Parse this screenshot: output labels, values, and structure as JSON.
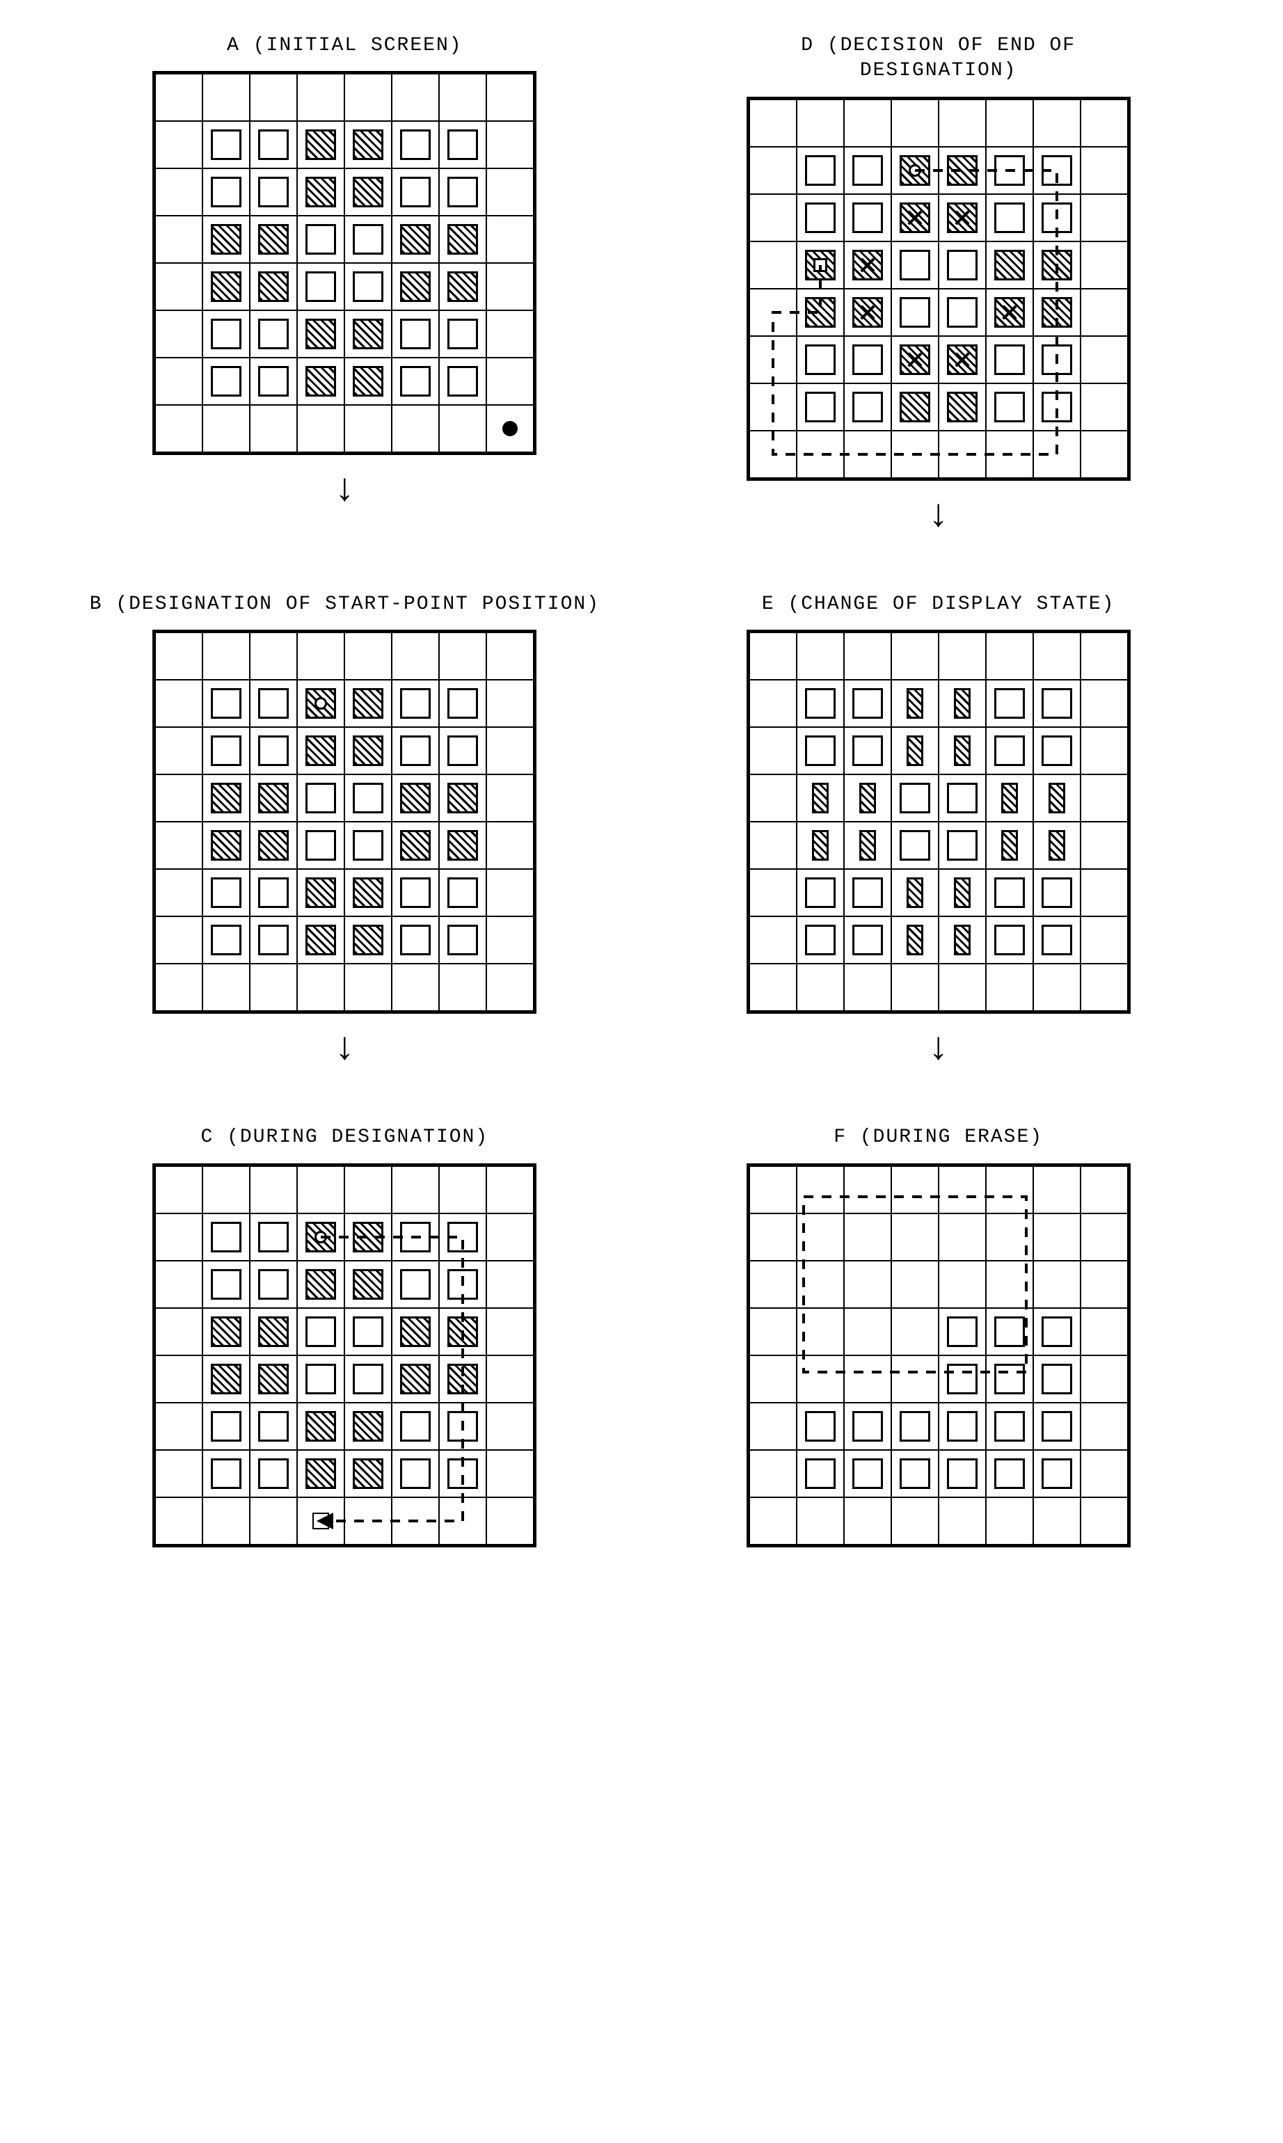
{
  "labels": {
    "A": "A (INITIAL SCREEN)",
    "B": "B (DESIGNATION OF START-POINT POSITION)",
    "C": "C (DURING DESIGNATION)",
    "D": "D (DECISION OF END OF\nDESIGNATION)",
    "E": "E (CHANGE OF DISPLAY STATE)",
    "F": "F (DURING ERASE)"
  },
  "cell_size": 68,
  "grid_dim": 8,
  "legend": {
    "empty": "empty tile (white square)",
    "hatched": "selected tile (diagonal hatch)",
    "half": "half-width hatched tile",
    "dot": "solid cursor dot",
    "ring": "start-point ring marker",
    "small": "small cursor square"
  },
  "grids": {
    "A": {
      "tiles": [
        {
          "r": 1,
          "c": 1,
          "t": "e"
        },
        {
          "r": 1,
          "c": 2,
          "t": "e"
        },
        {
          "r": 1,
          "c": 3,
          "t": "h"
        },
        {
          "r": 1,
          "c": 4,
          "t": "h"
        },
        {
          "r": 1,
          "c": 5,
          "t": "e"
        },
        {
          "r": 1,
          "c": 6,
          "t": "e"
        },
        {
          "r": 2,
          "c": 1,
          "t": "e"
        },
        {
          "r": 2,
          "c": 2,
          "t": "e"
        },
        {
          "r": 2,
          "c": 3,
          "t": "h"
        },
        {
          "r": 2,
          "c": 4,
          "t": "h"
        },
        {
          "r": 2,
          "c": 5,
          "t": "e"
        },
        {
          "r": 2,
          "c": 6,
          "t": "e"
        },
        {
          "r": 3,
          "c": 1,
          "t": "h"
        },
        {
          "r": 3,
          "c": 2,
          "t": "h"
        },
        {
          "r": 3,
          "c": 3,
          "t": "e"
        },
        {
          "r": 3,
          "c": 4,
          "t": "e"
        },
        {
          "r": 3,
          "c": 5,
          "t": "h"
        },
        {
          "r": 3,
          "c": 6,
          "t": "h"
        },
        {
          "r": 4,
          "c": 1,
          "t": "h"
        },
        {
          "r": 4,
          "c": 2,
          "t": "h"
        },
        {
          "r": 4,
          "c": 3,
          "t": "e"
        },
        {
          "r": 4,
          "c": 4,
          "t": "e"
        },
        {
          "r": 4,
          "c": 5,
          "t": "h"
        },
        {
          "r": 4,
          "c": 6,
          "t": "h"
        },
        {
          "r": 5,
          "c": 1,
          "t": "e"
        },
        {
          "r": 5,
          "c": 2,
          "t": "e"
        },
        {
          "r": 5,
          "c": 3,
          "t": "h"
        },
        {
          "r": 5,
          "c": 4,
          "t": "h"
        },
        {
          "r": 5,
          "c": 5,
          "t": "e"
        },
        {
          "r": 5,
          "c": 6,
          "t": "e"
        },
        {
          "r": 6,
          "c": 1,
          "t": "e"
        },
        {
          "r": 6,
          "c": 2,
          "t": "e"
        },
        {
          "r": 6,
          "c": 3,
          "t": "h"
        },
        {
          "r": 6,
          "c": 4,
          "t": "h"
        },
        {
          "r": 6,
          "c": 5,
          "t": "e"
        },
        {
          "r": 6,
          "c": 6,
          "t": "e"
        }
      ],
      "markers": [
        {
          "r": 7,
          "c": 7,
          "m": "dot"
        }
      ]
    },
    "B": {
      "tiles": [
        {
          "r": 1,
          "c": 1,
          "t": "e"
        },
        {
          "r": 1,
          "c": 2,
          "t": "e"
        },
        {
          "r": 1,
          "c": 3,
          "t": "h"
        },
        {
          "r": 1,
          "c": 4,
          "t": "h"
        },
        {
          "r": 1,
          "c": 5,
          "t": "e"
        },
        {
          "r": 1,
          "c": 6,
          "t": "e"
        },
        {
          "r": 2,
          "c": 1,
          "t": "e"
        },
        {
          "r": 2,
          "c": 2,
          "t": "e"
        },
        {
          "r": 2,
          "c": 3,
          "t": "h"
        },
        {
          "r": 2,
          "c": 4,
          "t": "h"
        },
        {
          "r": 2,
          "c": 5,
          "t": "e"
        },
        {
          "r": 2,
          "c": 6,
          "t": "e"
        },
        {
          "r": 3,
          "c": 1,
          "t": "h"
        },
        {
          "r": 3,
          "c": 2,
          "t": "h"
        },
        {
          "r": 3,
          "c": 3,
          "t": "e"
        },
        {
          "r": 3,
          "c": 4,
          "t": "e"
        },
        {
          "r": 3,
          "c": 5,
          "t": "h"
        },
        {
          "r": 3,
          "c": 6,
          "t": "h"
        },
        {
          "r": 4,
          "c": 1,
          "t": "h"
        },
        {
          "r": 4,
          "c": 2,
          "t": "h"
        },
        {
          "r": 4,
          "c": 3,
          "t": "e"
        },
        {
          "r": 4,
          "c": 4,
          "t": "e"
        },
        {
          "r": 4,
          "c": 5,
          "t": "h"
        },
        {
          "r": 4,
          "c": 6,
          "t": "h"
        },
        {
          "r": 5,
          "c": 1,
          "t": "e"
        },
        {
          "r": 5,
          "c": 2,
          "t": "e"
        },
        {
          "r": 5,
          "c": 3,
          "t": "h"
        },
        {
          "r": 5,
          "c": 4,
          "t": "h"
        },
        {
          "r": 5,
          "c": 5,
          "t": "e"
        },
        {
          "r": 5,
          "c": 6,
          "t": "e"
        },
        {
          "r": 6,
          "c": 1,
          "t": "e"
        },
        {
          "r": 6,
          "c": 2,
          "t": "e"
        },
        {
          "r": 6,
          "c": 3,
          "t": "h"
        },
        {
          "r": 6,
          "c": 4,
          "t": "h"
        },
        {
          "r": 6,
          "c": 5,
          "t": "e"
        },
        {
          "r": 6,
          "c": 6,
          "t": "e"
        }
      ],
      "markers": [
        {
          "r": 1,
          "c": 3,
          "m": "ring"
        }
      ]
    },
    "C": {
      "tiles": [
        {
          "r": 1,
          "c": 1,
          "t": "e"
        },
        {
          "r": 1,
          "c": 2,
          "t": "e"
        },
        {
          "r": 1,
          "c": 3,
          "t": "h"
        },
        {
          "r": 1,
          "c": 4,
          "t": "h"
        },
        {
          "r": 1,
          "c": 5,
          "t": "e"
        },
        {
          "r": 1,
          "c": 6,
          "t": "e"
        },
        {
          "r": 2,
          "c": 1,
          "t": "e"
        },
        {
          "r": 2,
          "c": 2,
          "t": "e"
        },
        {
          "r": 2,
          "c": 3,
          "t": "h"
        },
        {
          "r": 2,
          "c": 4,
          "t": "h"
        },
        {
          "r": 2,
          "c": 5,
          "t": "e"
        },
        {
          "r": 2,
          "c": 6,
          "t": "e"
        },
        {
          "r": 3,
          "c": 1,
          "t": "h"
        },
        {
          "r": 3,
          "c": 2,
          "t": "h"
        },
        {
          "r": 3,
          "c": 3,
          "t": "e"
        },
        {
          "r": 3,
          "c": 4,
          "t": "e"
        },
        {
          "r": 3,
          "c": 5,
          "t": "h"
        },
        {
          "r": 3,
          "c": 6,
          "t": "h"
        },
        {
          "r": 4,
          "c": 1,
          "t": "h"
        },
        {
          "r": 4,
          "c": 2,
          "t": "h"
        },
        {
          "r": 4,
          "c": 3,
          "t": "e"
        },
        {
          "r": 4,
          "c": 4,
          "t": "e"
        },
        {
          "r": 4,
          "c": 5,
          "t": "h"
        },
        {
          "r": 4,
          "c": 6,
          "t": "h"
        },
        {
          "r": 5,
          "c": 1,
          "t": "e"
        },
        {
          "r": 5,
          "c": 2,
          "t": "e"
        },
        {
          "r": 5,
          "c": 3,
          "t": "h"
        },
        {
          "r": 5,
          "c": 4,
          "t": "h"
        },
        {
          "r": 5,
          "c": 5,
          "t": "e"
        },
        {
          "r": 5,
          "c": 6,
          "t": "e"
        },
        {
          "r": 6,
          "c": 1,
          "t": "e"
        },
        {
          "r": 6,
          "c": 2,
          "t": "e"
        },
        {
          "r": 6,
          "c": 3,
          "t": "h"
        },
        {
          "r": 6,
          "c": 4,
          "t": "h"
        },
        {
          "r": 6,
          "c": 5,
          "t": "e"
        },
        {
          "r": 6,
          "c": 6,
          "t": "e"
        }
      ],
      "markers": [
        {
          "r": 1,
          "c": 3,
          "m": "ring"
        },
        {
          "r": 7,
          "c": 3,
          "m": "small"
        }
      ],
      "path_cells": [
        [
          1,
          3
        ],
        [
          1,
          4
        ],
        [
          1,
          5
        ],
        [
          1,
          6
        ],
        [
          2,
          6
        ],
        [
          3,
          6
        ],
        [
          4,
          6
        ],
        [
          5,
          6
        ],
        [
          6,
          6
        ],
        [
          7,
          6
        ],
        [
          7,
          5
        ],
        [
          7,
          4
        ],
        [
          7,
          3
        ]
      ],
      "arrow_end": [
        7,
        3
      ]
    },
    "D": {
      "tiles": [
        {
          "r": 1,
          "c": 1,
          "t": "e"
        },
        {
          "r": 1,
          "c": 2,
          "t": "e"
        },
        {
          "r": 1,
          "c": 3,
          "t": "h"
        },
        {
          "r": 1,
          "c": 4,
          "t": "h"
        },
        {
          "r": 1,
          "c": 5,
          "t": "e"
        },
        {
          "r": 1,
          "c": 6,
          "t": "e"
        },
        {
          "r": 2,
          "c": 1,
          "t": "e"
        },
        {
          "r": 2,
          "c": 2,
          "t": "e"
        },
        {
          "r": 2,
          "c": 3,
          "t": "h"
        },
        {
          "r": 2,
          "c": 4,
          "t": "h"
        },
        {
          "r": 2,
          "c": 5,
          "t": "e"
        },
        {
          "r": 2,
          "c": 6,
          "t": "e"
        },
        {
          "r": 3,
          "c": 1,
          "t": "h"
        },
        {
          "r": 3,
          "c": 2,
          "t": "h"
        },
        {
          "r": 3,
          "c": 3,
          "t": "e"
        },
        {
          "r": 3,
          "c": 4,
          "t": "e"
        },
        {
          "r": 3,
          "c": 5,
          "t": "h"
        },
        {
          "r": 3,
          "c": 6,
          "t": "h"
        },
        {
          "r": 4,
          "c": 1,
          "t": "h"
        },
        {
          "r": 4,
          "c": 2,
          "t": "h"
        },
        {
          "r": 4,
          "c": 3,
          "t": "e"
        },
        {
          "r": 4,
          "c": 4,
          "t": "e"
        },
        {
          "r": 4,
          "c": 5,
          "t": "h"
        },
        {
          "r": 4,
          "c": 6,
          "t": "h"
        },
        {
          "r": 5,
          "c": 1,
          "t": "e"
        },
        {
          "r": 5,
          "c": 2,
          "t": "e"
        },
        {
          "r": 5,
          "c": 3,
          "t": "h"
        },
        {
          "r": 5,
          "c": 4,
          "t": "h"
        },
        {
          "r": 5,
          "c": 5,
          "t": "e"
        },
        {
          "r": 5,
          "c": 6,
          "t": "e"
        },
        {
          "r": 6,
          "c": 1,
          "t": "e"
        },
        {
          "r": 6,
          "c": 2,
          "t": "e"
        },
        {
          "r": 6,
          "c": 3,
          "t": "h"
        },
        {
          "r": 6,
          "c": 4,
          "t": "h"
        },
        {
          "r": 6,
          "c": 5,
          "t": "e"
        },
        {
          "r": 6,
          "c": 6,
          "t": "e"
        }
      ],
      "markers": [
        {
          "r": 1,
          "c": 3,
          "m": "ring"
        },
        {
          "r": 3,
          "c": 1,
          "m": "inner"
        }
      ],
      "crosses": [
        [
          2,
          3
        ],
        [
          2,
          4
        ],
        [
          3,
          2
        ],
        [
          4,
          2
        ],
        [
          4,
          5
        ],
        [
          5,
          3
        ],
        [
          5,
          4
        ]
      ],
      "path_cells": [
        [
          1,
          3
        ],
        [
          1,
          4
        ],
        [
          1,
          5
        ],
        [
          1,
          6
        ],
        [
          2,
          6
        ],
        [
          3,
          6
        ],
        [
          4,
          6
        ],
        [
          5,
          6
        ],
        [
          6,
          6
        ],
        [
          7,
          6
        ],
        [
          7,
          5
        ],
        [
          7,
          4
        ],
        [
          7,
          3
        ],
        [
          7,
          2
        ],
        [
          7,
          1
        ],
        [
          7,
          0
        ],
        [
          6,
          0
        ],
        [
          5,
          0
        ],
        [
          4,
          0
        ],
        [
          4,
          1
        ],
        [
          3,
          1
        ]
      ]
    },
    "E": {
      "tiles": [
        {
          "r": 1,
          "c": 1,
          "t": "e"
        },
        {
          "r": 1,
          "c": 2,
          "t": "e"
        },
        {
          "r": 1,
          "c": 3,
          "t": "hh"
        },
        {
          "r": 1,
          "c": 4,
          "t": "hh"
        },
        {
          "r": 1,
          "c": 5,
          "t": "e"
        },
        {
          "r": 1,
          "c": 6,
          "t": "e"
        },
        {
          "r": 2,
          "c": 1,
          "t": "e"
        },
        {
          "r": 2,
          "c": 2,
          "t": "e"
        },
        {
          "r": 2,
          "c": 3,
          "t": "hh"
        },
        {
          "r": 2,
          "c": 4,
          "t": "hh"
        },
        {
          "r": 2,
          "c": 5,
          "t": "e"
        },
        {
          "r": 2,
          "c": 6,
          "t": "e"
        },
        {
          "r": 3,
          "c": 1,
          "t": "hh"
        },
        {
          "r": 3,
          "c": 2,
          "t": "hh"
        },
        {
          "r": 3,
          "c": 3,
          "t": "e"
        },
        {
          "r": 3,
          "c": 4,
          "t": "e"
        },
        {
          "r": 3,
          "c": 5,
          "t": "hh"
        },
        {
          "r": 3,
          "c": 6,
          "t": "hh"
        },
        {
          "r": 4,
          "c": 1,
          "t": "hh"
        },
        {
          "r": 4,
          "c": 2,
          "t": "hh"
        },
        {
          "r": 4,
          "c": 3,
          "t": "e"
        },
        {
          "r": 4,
          "c": 4,
          "t": "e"
        },
        {
          "r": 4,
          "c": 5,
          "t": "hh"
        },
        {
          "r": 4,
          "c": 6,
          "t": "hh"
        },
        {
          "r": 5,
          "c": 1,
          "t": "e"
        },
        {
          "r": 5,
          "c": 2,
          "t": "e"
        },
        {
          "r": 5,
          "c": 3,
          "t": "hh"
        },
        {
          "r": 5,
          "c": 4,
          "t": "hh"
        },
        {
          "r": 5,
          "c": 5,
          "t": "e"
        },
        {
          "r": 5,
          "c": 6,
          "t": "e"
        },
        {
          "r": 6,
          "c": 1,
          "t": "e"
        },
        {
          "r": 6,
          "c": 2,
          "t": "e"
        },
        {
          "r": 6,
          "c": 3,
          "t": "hh"
        },
        {
          "r": 6,
          "c": 4,
          "t": "hh"
        },
        {
          "r": 6,
          "c": 5,
          "t": "e"
        },
        {
          "r": 6,
          "c": 6,
          "t": "e"
        }
      ]
    },
    "F": {
      "tiles": [
        {
          "r": 3,
          "c": 4,
          "t": "e"
        },
        {
          "r": 3,
          "c": 5,
          "t": "e"
        },
        {
          "r": 3,
          "c": 6,
          "t": "e"
        },
        {
          "r": 4,
          "c": 4,
          "t": "e"
        },
        {
          "r": 4,
          "c": 5,
          "t": "e"
        },
        {
          "r": 4,
          "c": 6,
          "t": "e"
        },
        {
          "r": 5,
          "c": 1,
          "t": "e"
        },
        {
          "r": 5,
          "c": 2,
          "t": "e"
        },
        {
          "r": 5,
          "c": 3,
          "t": "e"
        },
        {
          "r": 5,
          "c": 4,
          "t": "e"
        },
        {
          "r": 5,
          "c": 5,
          "t": "e"
        },
        {
          "r": 5,
          "c": 6,
          "t": "e"
        },
        {
          "r": 6,
          "c": 1,
          "t": "e"
        },
        {
          "r": 6,
          "c": 2,
          "t": "e"
        },
        {
          "r": 6,
          "c": 3,
          "t": "e"
        },
        {
          "r": 6,
          "c": 4,
          "t": "e"
        },
        {
          "r": 6,
          "c": 5,
          "t": "e"
        },
        {
          "r": 6,
          "c": 6,
          "t": "e"
        }
      ],
      "dashed_box": {
        "r0": 0.5,
        "c0": 1,
        "r1": 4.5,
        "c1": 6
      }
    }
  },
  "flow": [
    "A",
    "B",
    "C",
    "D",
    "E",
    "F"
  ],
  "flow_connector": "C→D via long arrow"
}
